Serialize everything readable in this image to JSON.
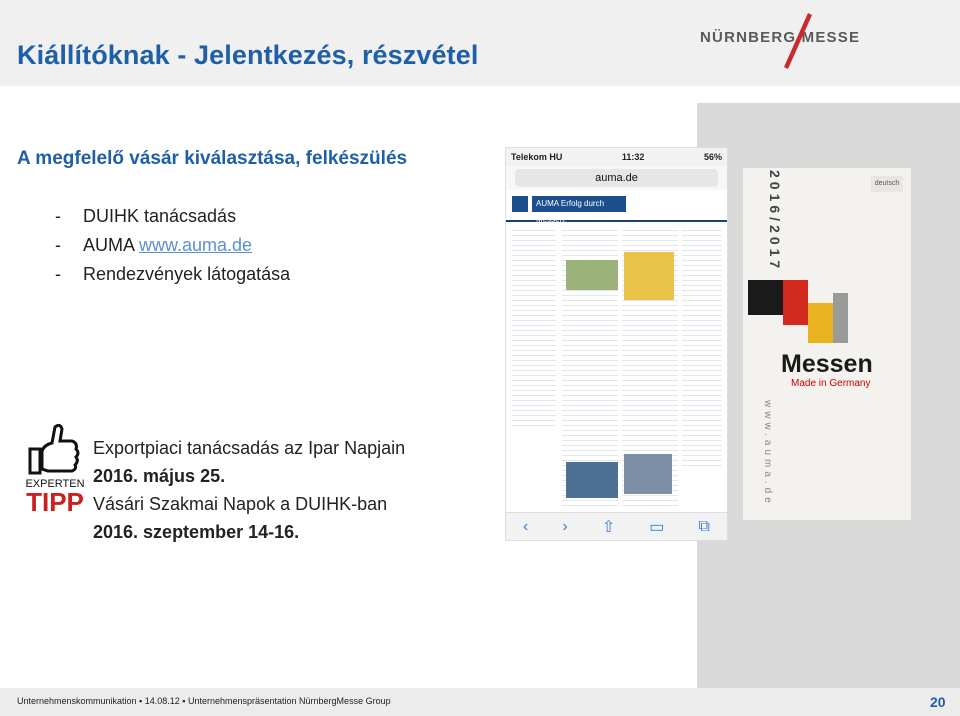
{
  "header": {
    "title": "Kiállítóknak - Jelentkezés, részvétel",
    "logo_text": "NÜRNBERG MESSE"
  },
  "content": {
    "subtitle": "A megfelelő vásár kiválasztása, felkészülés",
    "bullets": [
      {
        "dash": "-",
        "text": "DUIHK tanácsadás",
        "link": ""
      },
      {
        "dash": "-",
        "text": "AUMA ",
        "link": "www.auma.de"
      },
      {
        "dash": "-",
        "text": "Rendezvények látogatása",
        "link": ""
      }
    ],
    "event_lines": [
      "Exportpiaci tanácsadás az Ipar Napjain",
      "2016. május  25.",
      "Vásári Szakmai Napok a DUIHK-ban",
      "2016. szeptember 14-16."
    ]
  },
  "phone": {
    "carrier": "Telekom HU",
    "time": "11:32",
    "battery": "56%",
    "url": "auma.de",
    "banner": "AUMA Erfolg durch Messen."
  },
  "book": {
    "year": "2016/2017",
    "lang": "deutsch",
    "title": "Messen",
    "subtitle": "Made in Germany",
    "url": "www.auma.de"
  },
  "tipp_logo": {
    "line1": "EXPERTEN",
    "line2": "TIPP"
  },
  "footer": {
    "text": "Unternehmenskommunikation  ▪ 14.08.12 ▪ Unternehmenspräsentation NürnbergMesse Group",
    "page_number": "20"
  },
  "colors": {
    "accent_blue": "#1f5fa8",
    "link_blue": "#5b8fd6",
    "header_bg": "#f0f0f0",
    "tipp_red": "#cc1f1f"
  }
}
